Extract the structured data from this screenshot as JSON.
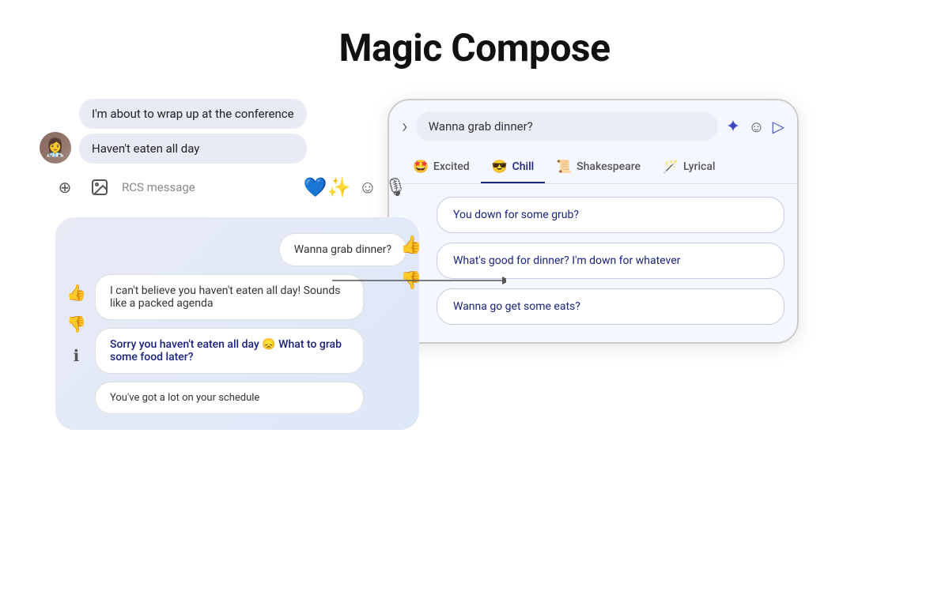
{
  "title": "Magic Compose",
  "chat": {
    "messages_top": [
      "I'm about to wrap up at the conference",
      "Haven't eaten all day"
    ],
    "input_placeholder": "RCS message",
    "suggestions_left": [
      {
        "text": "Wanna grab dinner?",
        "type": "sent"
      },
      {
        "text": "I can't believe you haven't eaten all day! Sounds like a packed agenda",
        "type": "received"
      },
      {
        "text": "Sorry you haven't eaten all day 😞 What to grab some food later?",
        "type": "received-bold"
      },
      {
        "text": "You've got a lot on your schedule",
        "type": "received"
      }
    ]
  },
  "compose_panel": {
    "input_text": "Wanna grab dinner?",
    "tone_tabs": [
      {
        "emoji": "🤩",
        "label": "Excited",
        "active": false
      },
      {
        "emoji": "😎",
        "label": "Chill",
        "active": true
      },
      {
        "emoji": "📜",
        "label": "Shakespeare",
        "active": false
      },
      {
        "emoji": "🪄",
        "label": "Lyrical",
        "active": false
      }
    ],
    "suggestions": [
      "You down for some grub?",
      "What's good for dinner? I'm down for whatever",
      "Wanna go get some eats?"
    ]
  },
  "icons": {
    "add": "⊕",
    "image": "🖼",
    "heart_send": "💙",
    "emoji": "☺",
    "mic": "🎙",
    "thumbs_up": "👍",
    "thumbs_down": "👎",
    "info": "ℹ",
    "back_arrow": "›",
    "magic_pencil": "✦",
    "send": "▷"
  }
}
